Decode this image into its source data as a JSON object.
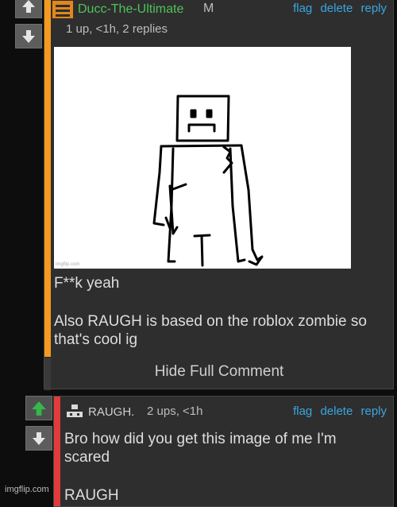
{
  "comment1": {
    "username": "Ducc-The-Ultimate",
    "badge": "M",
    "meta": "1 up, <1h, 2 replies",
    "actions": [
      "flag",
      "delete",
      "reply"
    ],
    "text_line1": "F**k yeah",
    "text_line2": "Also RAUGH is based on the roblox zombie so that's cool ig",
    "image_watermark": "imgflip.com",
    "hide_label": "Hide Full Comment",
    "stripe_color": "#f39a1f",
    "username_color": "#4fc25a"
  },
  "comment2": {
    "username": "RAUGH.",
    "meta": "2 ups, <1h",
    "actions": [
      "flag",
      "delete",
      "reply"
    ],
    "text": "Bro how did you get this image of me I'm scared",
    "text_tail": "RAUGH",
    "stripe_color": "#e23b3b"
  },
  "site_watermark": "imgflip.com",
  "colors": {
    "link": "#3aa6e0",
    "upvote_active": "#34b84a",
    "background": "#0d0d0d",
    "panel": "#2e2e2e"
  }
}
